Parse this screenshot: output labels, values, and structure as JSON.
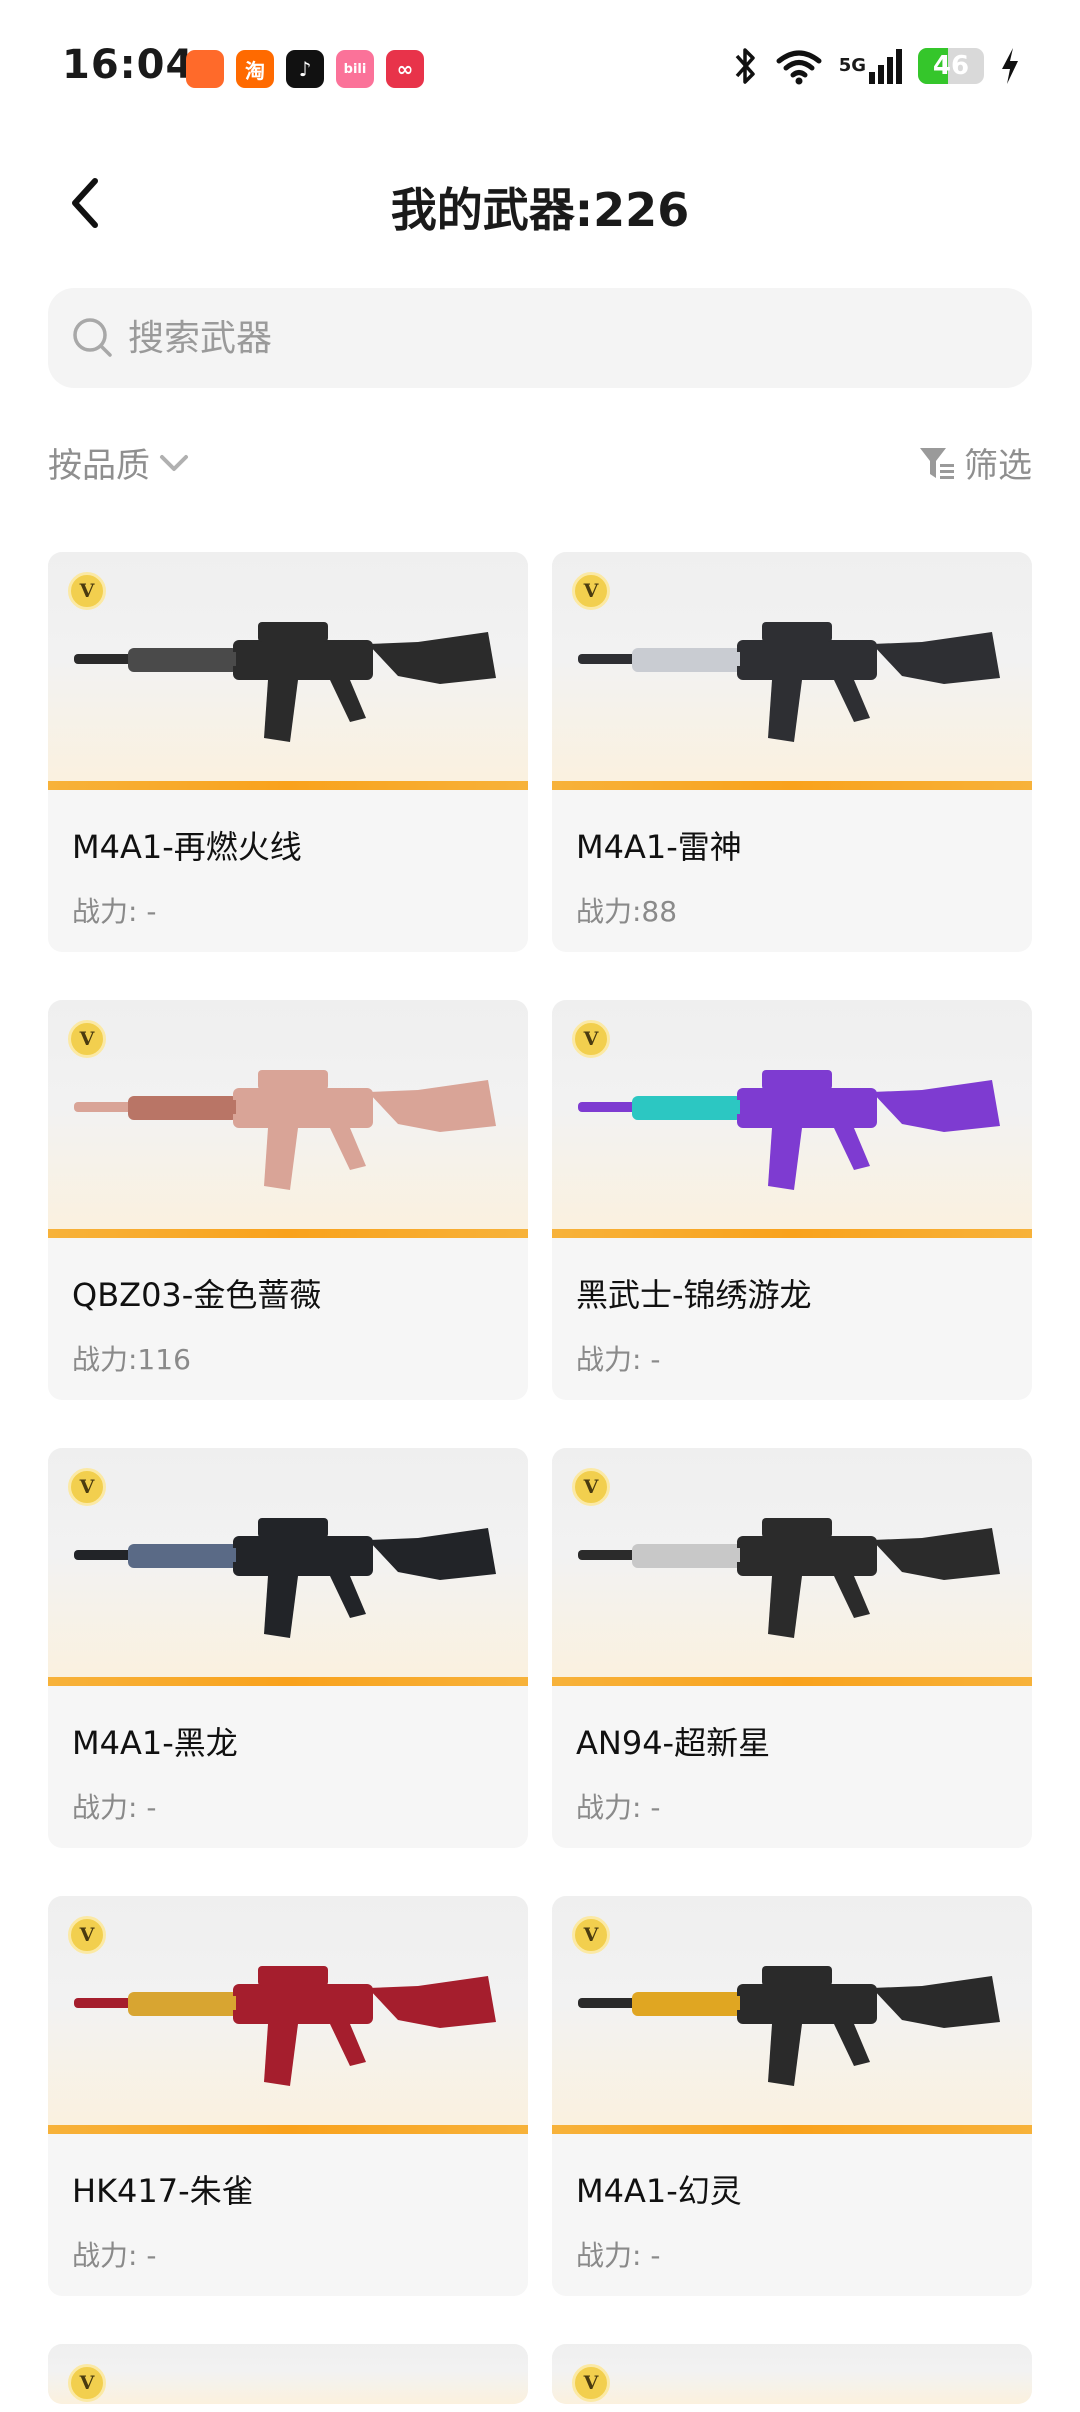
{
  "status_bar": {
    "time": "16:04",
    "apps": [
      {
        "icon": "app-icon-orange",
        "color": "#ff6a2a",
        "label": ""
      },
      {
        "icon": "taobao-icon",
        "color": "#ff6a00",
        "label": "淘"
      },
      {
        "icon": "douyin-icon",
        "color": "#111111",
        "label": "♪"
      },
      {
        "icon": "bilibili-icon",
        "color": "#fb7299",
        "label": "bili"
      },
      {
        "icon": "app-icon-red",
        "color": "#e8334a",
        "label": "∞"
      }
    ],
    "network": "5G",
    "battery": 46
  },
  "header": {
    "title": "我的武器:226"
  },
  "search": {
    "placeholder": "搜索武器",
    "value": ""
  },
  "controls": {
    "sort_label": "按品质",
    "filter_label": "筛选"
  },
  "colors": {
    "accent_bar": "#f9a21c",
    "badge": "#f2cf4e",
    "battery_fill": "#35c62b"
  },
  "weapons": [
    {
      "name": "M4A1-再燃火线",
      "power": "战力: -",
      "badge": "V",
      "gun_color": "#2b2b2b",
      "accent": "#4a4a4a"
    },
    {
      "name": "M4A1-雷神",
      "power": "战力:88",
      "badge": "V",
      "gun_color": "#2e2f33",
      "accent": "#c9ccd2"
    },
    {
      "name": "QBZ03-金色蔷薇",
      "power": "战力:116",
      "badge": "V",
      "gun_color": "#d9a497",
      "accent": "#b97566"
    },
    {
      "name": "黑武士-锦绣游龙",
      "power": "战力: -",
      "badge": "V",
      "gun_color": "#7e3bd1",
      "accent": "#2cc7c2"
    },
    {
      "name": "M4A1-黑龙",
      "power": "战力: -",
      "badge": "V",
      "gun_color": "#222428",
      "accent": "#5a6a86"
    },
    {
      "name": "AN94-超新星",
      "power": "战力: -",
      "badge": "V",
      "gun_color": "#2b2b2b",
      "accent": "#c8c8c8"
    },
    {
      "name": "HK417-朱雀",
      "power": "战力: -",
      "badge": "V",
      "gun_color": "#a51e2d",
      "accent": "#d8a531"
    },
    {
      "name": "M4A1-幻灵",
      "power": "战力: -",
      "badge": "V",
      "gun_color": "#2a2a2a",
      "accent": "#e0a622"
    },
    {
      "name": "",
      "power": "",
      "badge": "V",
      "gun_color": "#2a2a2a",
      "accent": "#2a2a2a"
    },
    {
      "name": "",
      "power": "",
      "badge": "V",
      "gun_color": "#2a2a2a",
      "accent": "#e0a622"
    }
  ]
}
